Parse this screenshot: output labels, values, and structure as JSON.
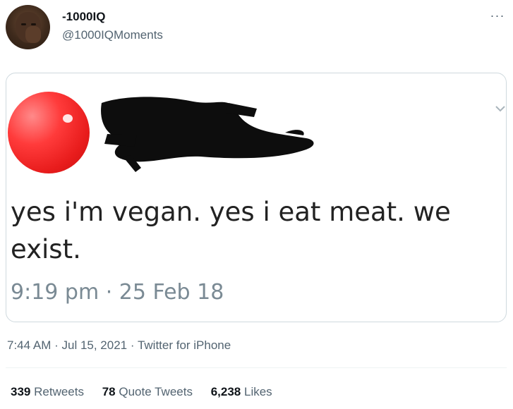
{
  "tweet": {
    "display_name": "-1000IQ",
    "handle": "@1000IQMoments",
    "more_icon": "···",
    "timestamp": "7:44 AM",
    "date": "Jul 15, 2021",
    "source": "Twitter for iPhone",
    "separator": " · "
  },
  "embedded_image": {
    "text": "yes i'm vegan. yes i eat meat. we exist.",
    "time": "9:19 pm · 25 Feb 18"
  },
  "stats": [
    {
      "count": "339",
      "label": "Retweets"
    },
    {
      "count": "78",
      "label": "Quote Tweets"
    },
    {
      "count": "6,238",
      "label": "Likes"
    }
  ],
  "colors": {
    "primary_text": "#0f1419",
    "secondary_text": "#536471",
    "border": "#cfd9de",
    "avatar_red": "#e81c1c"
  }
}
